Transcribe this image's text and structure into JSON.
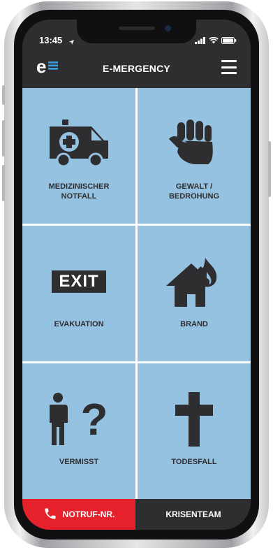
{
  "status_bar": {
    "time": "13:45"
  },
  "header": {
    "logo_text": "e",
    "title": "E-MERGENCY"
  },
  "tiles": [
    {
      "label": "MEDIZINISCHER\nNOTFALL",
      "icon": "ambulance-icon"
    },
    {
      "label": "GEWALT /\nBEDROHUNG",
      "icon": "fist-icon"
    },
    {
      "label": "EVAKUATION",
      "icon": "exit-sign-icon",
      "icon_text": "EXIT"
    },
    {
      "label": "BRAND",
      "icon": "burning-house-icon"
    },
    {
      "label": "VERMISST",
      "icon": "missing-person-icon",
      "icon_text": "?"
    },
    {
      "label": "TODESFALL",
      "icon": "cross-icon"
    }
  ],
  "bottom_bar": {
    "emergency_label": "NOTRUF-NR.",
    "crisis_team_label": "KRISENTEAM"
  },
  "colors": {
    "tile": "#96c2e2",
    "dark": "#2e2e30",
    "emergency_red": "#e5212c",
    "logo_blue": "#3aa0e0"
  }
}
